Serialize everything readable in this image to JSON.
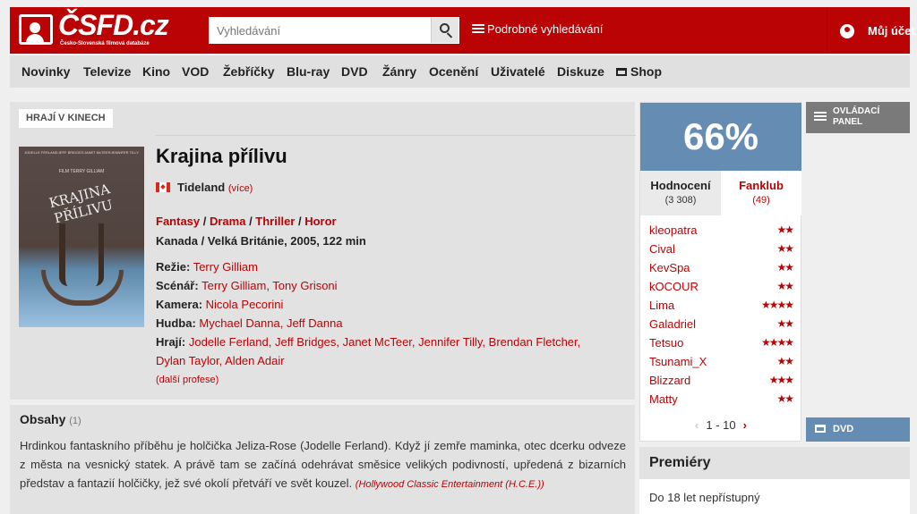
{
  "header": {
    "logo_text": "ČSFD.cz",
    "logo_subtitle": "Česko-Slovenská filmová databáze",
    "search_placeholder": "Vyhledávání",
    "advanced_search": "Podrobné vyhledávání",
    "account": "Můj účet"
  },
  "nav": [
    "Novinky",
    "Televize",
    "Kino",
    "VOD",
    "Žebříčky",
    "Blu-ray",
    "DVD",
    "Žánry",
    "Ocenění",
    "Uživatelé",
    "Diskuze",
    "Shop"
  ],
  "movie": {
    "badge": "HRAJÍ V KINECH",
    "title": "Krajina přílivu",
    "original_title": "Tideland",
    "more_titles": "(více)",
    "genres": [
      "Fantasy",
      "Drama",
      "Thriller",
      "Horor"
    ],
    "origin": "Kanada / Velká Británie, 2005, 122 min",
    "credits": [
      {
        "label": "Režie:",
        "people": "Terry Gilliam"
      },
      {
        "label": "Scénář:",
        "people": "Terry Gilliam, Tony Grisoni"
      },
      {
        "label": "Kamera:",
        "people": "Nicola Pecorini"
      },
      {
        "label": "Hudba:",
        "people": "Mychael Danna, Jeff Danna"
      },
      {
        "label": "Hrají:",
        "people": "Jodelle Ferland, Jeff Bridges, Janet McTeer, Jennifer Tilly, Brendan Fletcher,"
      },
      {
        "label": "",
        "people": "Dylan Taylor, Alden Adair"
      }
    ],
    "more_professions": "(další profese)",
    "poster": {
      "cast": [
        "JODELLE FERLAND",
        "JEFF BRIDGES",
        "JANET McTEER",
        "JENNIFER TILLY"
      ],
      "director": "FILM TERRY GILLIAM",
      "title": "KRAJINA PŘÍLIVU"
    }
  },
  "plot": {
    "heading": "Obsahy",
    "count": "(1)",
    "text": "Hrdinkou fantaskního příběhu je holčička Jeliza-Rose (Jodelle Ferland). Když jí zemře maminka, otec dcerku odveze z města na vesnický statek. A právě tam se začíná odehrávat směsice velikých podivností, upředená z bizarních představ a fantazií holčičky, jež své okolí přetváří ve svět kouzel.",
    "source": "(Hollywood Classic Entertainment (H.C.E.))"
  },
  "rating": {
    "score": "66%",
    "tab_ratings": "Hodnocení",
    "tab_ratings_count": "(3 308)",
    "tab_fanclub": "Fanklub",
    "tab_fanclub_count": "(49)",
    "users": [
      {
        "name": "kleopatra",
        "stars": "★★"
      },
      {
        "name": "Cival",
        "stars": "★★"
      },
      {
        "name": "KevSpa",
        "stars": "★★"
      },
      {
        "name": "kOCOUR",
        "stars": "★★"
      },
      {
        "name": "Lima",
        "stars": "★★★★"
      },
      {
        "name": "Galadriel",
        "stars": "★★"
      },
      {
        "name": "Tetsuo",
        "stars": "★★★★"
      },
      {
        "name": "Tsunami_X",
        "stars": "★★"
      },
      {
        "name": "Blizzard",
        "stars": "★★★"
      },
      {
        "name": "Matty",
        "stars": "★★"
      }
    ],
    "pager": "1 - 10"
  },
  "sidebar": {
    "control_panel": "OVLÁDACÍ PANEL",
    "dvd": "DVD",
    "premieres_heading": "Premiéry",
    "premieres_text": "Do 18 let nepřístupný"
  },
  "colors": {
    "brand": "#ba0305",
    "score_bg": "#658db4"
  }
}
